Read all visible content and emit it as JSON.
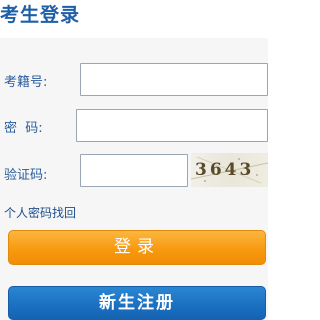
{
  "header": {
    "title": "考生登录"
  },
  "form": {
    "exam_id_label": "考籍号:",
    "exam_id_value": "",
    "password_label": "密  码:",
    "password_value": "",
    "captcha_label": "验证码:",
    "captcha_value": "",
    "captcha_image_text": "3643"
  },
  "links": {
    "retrieve_password": "个人密码找回"
  },
  "buttons": {
    "login": "登录",
    "register": "新生注册"
  },
  "colors": {
    "title_blue": "#1d5fa8",
    "login_orange": "#f89a10",
    "register_blue": "#1a6fc0",
    "panel_bg": "#f6f6f6"
  }
}
